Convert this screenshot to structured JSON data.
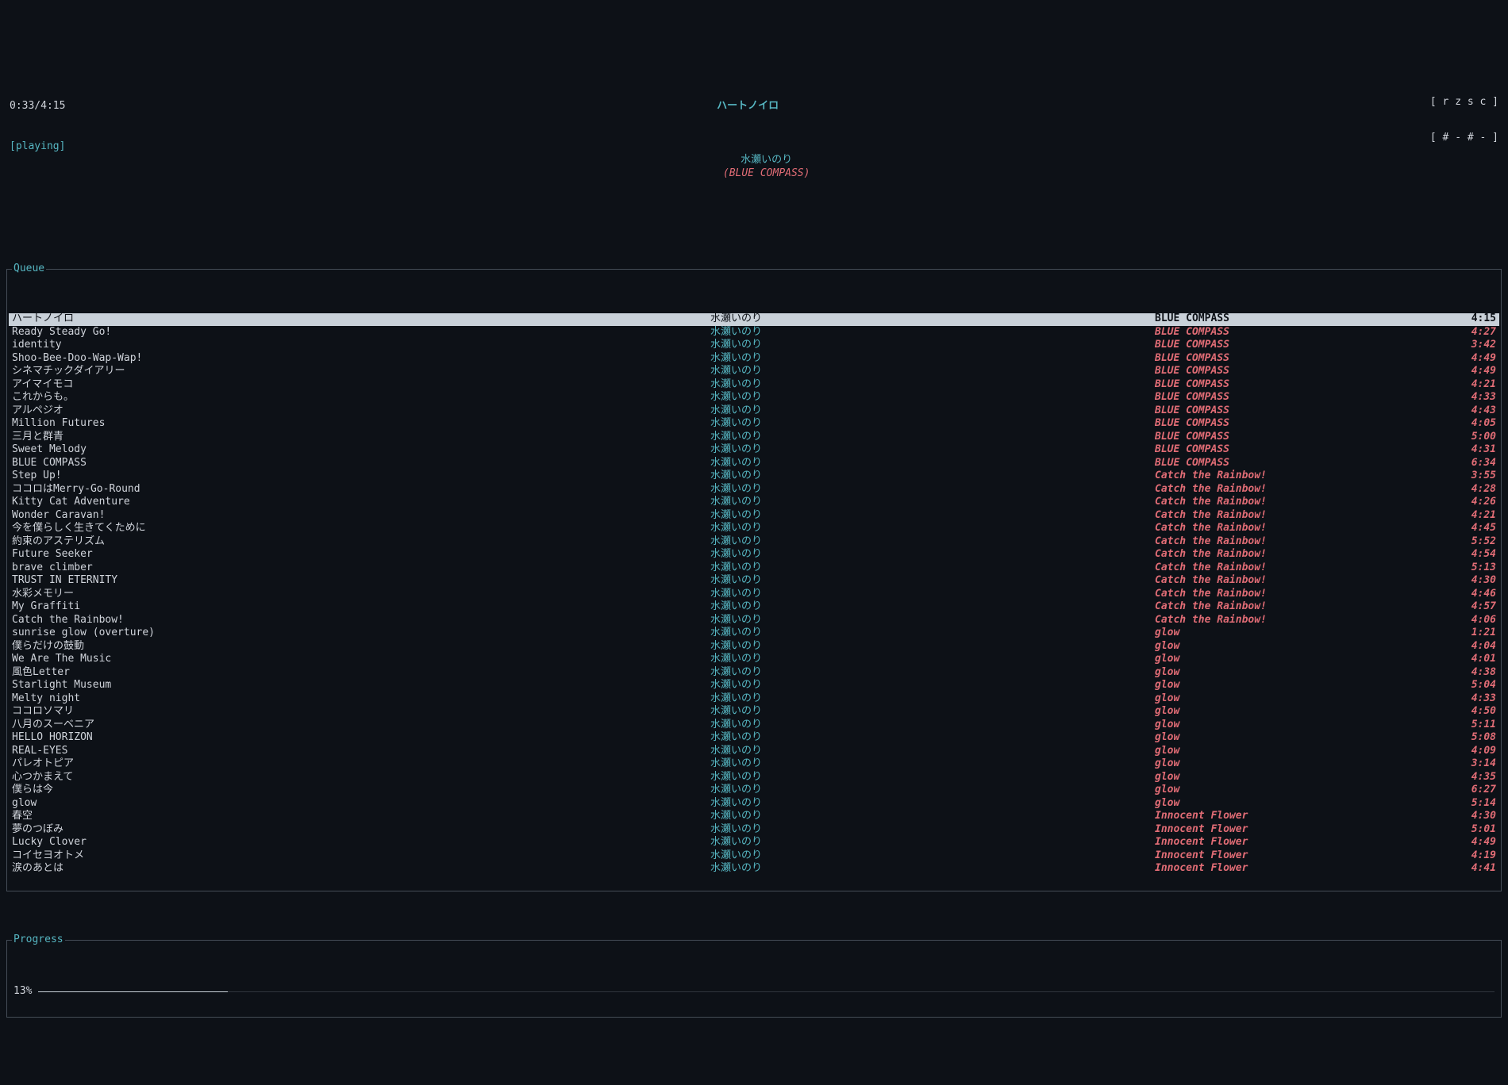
{
  "header": {
    "time": "0:33/4:15",
    "status": "[playing]",
    "title": "ハートノイロ",
    "artist": "水瀬いのり",
    "album": "(BLUE COMPASS)",
    "flags_line1": "[ r z s c ]",
    "flags_line2": "[ # - # - ]"
  },
  "queue_title": "Queue",
  "queue": [
    {
      "title": "ハートノイロ",
      "artist": "水瀬いのり",
      "album": "BLUE COMPASS",
      "dur": "4:15",
      "selected": true
    },
    {
      "title": "Ready Steady Go!",
      "artist": "水瀬いのり",
      "album": "BLUE COMPASS",
      "dur": "4:27"
    },
    {
      "title": "identity",
      "artist": "水瀬いのり",
      "album": "BLUE COMPASS",
      "dur": "3:42"
    },
    {
      "title": "Shoo-Bee-Doo-Wap-Wap!",
      "artist": "水瀬いのり",
      "album": "BLUE COMPASS",
      "dur": "4:49"
    },
    {
      "title": "シネマチックダイアリー",
      "artist": "水瀬いのり",
      "album": "BLUE COMPASS",
      "dur": "4:49"
    },
    {
      "title": "アイマイモコ",
      "artist": "水瀬いのり",
      "album": "BLUE COMPASS",
      "dur": "4:21"
    },
    {
      "title": "これからも。",
      "artist": "水瀬いのり",
      "album": "BLUE COMPASS",
      "dur": "4:33"
    },
    {
      "title": "アルペジオ",
      "artist": "水瀬いのり",
      "album": "BLUE COMPASS",
      "dur": "4:43"
    },
    {
      "title": "Million Futures",
      "artist": "水瀬いのり",
      "album": "BLUE COMPASS",
      "dur": "4:05"
    },
    {
      "title": "三月と群青",
      "artist": "水瀬いのり",
      "album": "BLUE COMPASS",
      "dur": "5:00"
    },
    {
      "title": "Sweet Melody",
      "artist": "水瀬いのり",
      "album": "BLUE COMPASS",
      "dur": "4:31"
    },
    {
      "title": "BLUE COMPASS",
      "artist": "水瀬いのり",
      "album": "BLUE COMPASS",
      "dur": "6:34"
    },
    {
      "title": "Step Up!",
      "artist": "水瀬いのり",
      "album": "Catch the Rainbow!",
      "dur": "3:55"
    },
    {
      "title": "ココロはMerry-Go-Round",
      "artist": "水瀬いのり",
      "album": "Catch the Rainbow!",
      "dur": "4:28"
    },
    {
      "title": "Kitty Cat Adventure",
      "artist": "水瀬いのり",
      "album": "Catch the Rainbow!",
      "dur": "4:26"
    },
    {
      "title": "Wonder Caravan!",
      "artist": "水瀬いのり",
      "album": "Catch the Rainbow!",
      "dur": "4:21"
    },
    {
      "title": "今を僕らしく生きてくために",
      "artist": "水瀬いのり",
      "album": "Catch the Rainbow!",
      "dur": "4:45"
    },
    {
      "title": "約束のアステリズム",
      "artist": "水瀬いのり",
      "album": "Catch the Rainbow!",
      "dur": "5:52"
    },
    {
      "title": "Future Seeker",
      "artist": "水瀬いのり",
      "album": "Catch the Rainbow!",
      "dur": "4:54"
    },
    {
      "title": "brave climber",
      "artist": "水瀬いのり",
      "album": "Catch the Rainbow!",
      "dur": "5:13"
    },
    {
      "title": "TRUST IN ETERNITY",
      "artist": "水瀬いのり",
      "album": "Catch the Rainbow!",
      "dur": "4:30"
    },
    {
      "title": "水彩メモリー",
      "artist": "水瀬いのり",
      "album": "Catch the Rainbow!",
      "dur": "4:46"
    },
    {
      "title": "My Graffiti",
      "artist": "水瀬いのり",
      "album": "Catch the Rainbow!",
      "dur": "4:57"
    },
    {
      "title": "Catch the Rainbow!",
      "artist": "水瀬いのり",
      "album": "Catch the Rainbow!",
      "dur": "4:06"
    },
    {
      "title": "sunrise glow (overture)",
      "artist": "水瀬いのり",
      "album": "glow",
      "dur": "1:21"
    },
    {
      "title": "僕らだけの鼓動",
      "artist": "水瀬いのり",
      "album": "glow",
      "dur": "4:04"
    },
    {
      "title": "We Are The Music",
      "artist": "水瀬いのり",
      "album": "glow",
      "dur": "4:01"
    },
    {
      "title": "風色Letter",
      "artist": "水瀬いのり",
      "album": "glow",
      "dur": "4:38"
    },
    {
      "title": "Starlight Museum",
      "artist": "水瀬いのり",
      "album": "glow",
      "dur": "5:04"
    },
    {
      "title": "Melty night",
      "artist": "水瀬いのり",
      "album": "glow",
      "dur": "4:33"
    },
    {
      "title": "ココロソマリ",
      "artist": "水瀬いのり",
      "album": "glow",
      "dur": "4:50"
    },
    {
      "title": "八月のスーベニア",
      "artist": "水瀬いのり",
      "album": "glow",
      "dur": "5:11"
    },
    {
      "title": "HELLO HORIZON",
      "artist": "水瀬いのり",
      "album": "glow",
      "dur": "5:08"
    },
    {
      "title": "REAL-EYES",
      "artist": "水瀬いのり",
      "album": "glow",
      "dur": "4:09"
    },
    {
      "title": "パレオトピア",
      "artist": "水瀬いのり",
      "album": "glow",
      "dur": "3:14"
    },
    {
      "title": "心つかまえて",
      "artist": "水瀬いのり",
      "album": "glow",
      "dur": "4:35"
    },
    {
      "title": "僕らは今",
      "artist": "水瀬いのり",
      "album": "glow",
      "dur": "6:27"
    },
    {
      "title": "glow",
      "artist": "水瀬いのり",
      "album": "glow",
      "dur": "5:14"
    },
    {
      "title": "春空",
      "artist": "水瀬いのり",
      "album": "Innocent Flower",
      "dur": "4:30"
    },
    {
      "title": "夢のつぼみ",
      "artist": "水瀬いのり",
      "album": "Innocent Flower",
      "dur": "5:01"
    },
    {
      "title": "Lucky Clover",
      "artist": "水瀬いのり",
      "album": "Innocent Flower",
      "dur": "4:49"
    },
    {
      "title": "コイセヨオトメ",
      "artist": "水瀬いのり",
      "album": "Innocent Flower",
      "dur": "4:19"
    },
    {
      "title": "涙のあとは",
      "artist": "水瀬いのり",
      "album": "Innocent Flower",
      "dur": "4:41"
    }
  ],
  "progress": {
    "title": "Progress",
    "percent_label": "13%",
    "percent": 13
  }
}
